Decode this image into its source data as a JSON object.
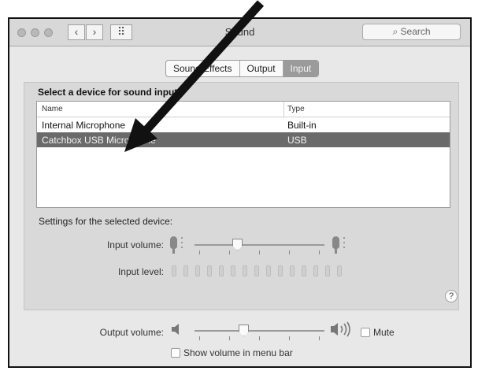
{
  "window": {
    "title": "Sound"
  },
  "toolbar": {
    "back_glyph": "‹",
    "forward_glyph": "›",
    "grid_glyph": "⠿",
    "search_placeholder": "Search"
  },
  "tabs": [
    {
      "label": "Sound Effects",
      "selected": false
    },
    {
      "label": "Output",
      "selected": false
    },
    {
      "label": "Input",
      "selected": true
    }
  ],
  "input": {
    "heading": "Select a device for sound input:",
    "columns": {
      "name": "Name",
      "type": "Type"
    },
    "devices": [
      {
        "name": "Internal Microphone",
        "type": "Built-in",
        "selected": false
      },
      {
        "name": "Catchbox USB Microphone",
        "type": "USB",
        "selected": true
      }
    ],
    "settings_label": "Settings for the selected device:",
    "input_volume_label": "Input volume:",
    "input_volume_value": 0.33,
    "input_level_label": "Input level:",
    "input_level_segments": 15,
    "help_glyph": "?"
  },
  "output": {
    "volume_label": "Output volume:",
    "volume_value": 0.38,
    "mute_label": "Mute",
    "mute_checked": false,
    "show_in_menubar_label": "Show volume in menu bar",
    "show_in_menubar_checked": false
  },
  "colors": {
    "selected_row": "#6a6a6a",
    "selected_tab": "#9b9b9b",
    "annotation_arrow": "#111111"
  }
}
